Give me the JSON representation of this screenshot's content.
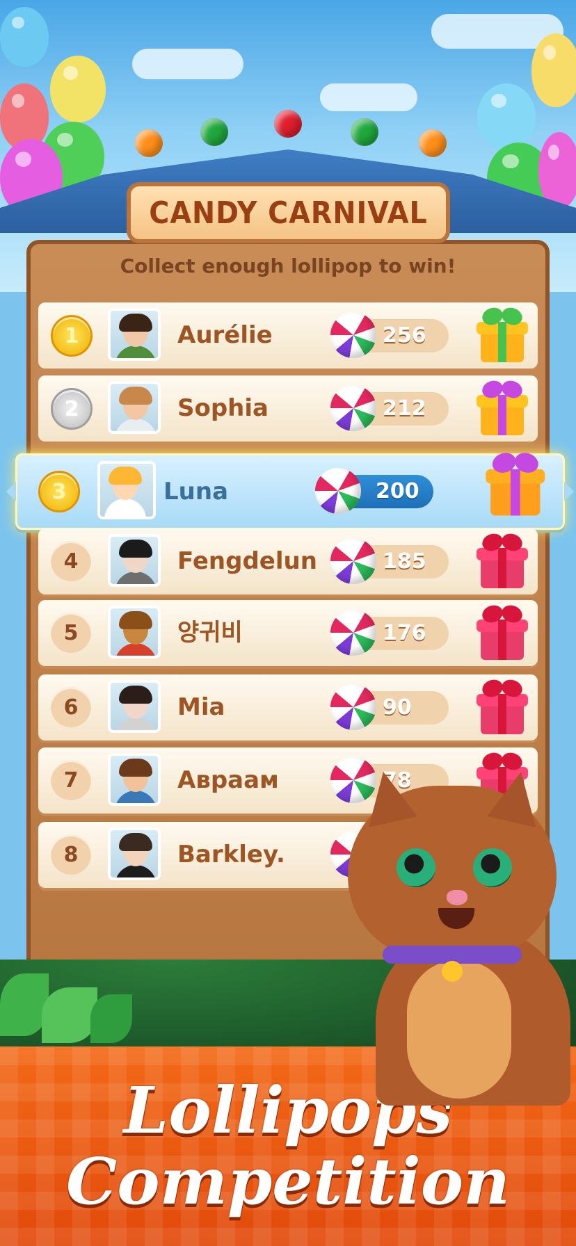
{
  "event": {
    "title": "CANDY CARNIVAL",
    "subtitle": "Collect enough lollipop to win!"
  },
  "leaderboard": [
    {
      "rank": "1",
      "name": "Aurélie",
      "score": "256",
      "medal": "gold",
      "highlight": false,
      "gift_color": "#ffb21a"
    },
    {
      "rank": "2",
      "name": "Sophia",
      "score": "212",
      "medal": "silver",
      "highlight": false,
      "gift_color": "#ffb21a"
    },
    {
      "rank": "3",
      "name": "Luna",
      "score": "200",
      "medal": "gold",
      "highlight": true,
      "gift_color": "#f7a21c"
    },
    {
      "rank": "4",
      "name": "Fengdelun",
      "score": "185",
      "medal": "plain",
      "highlight": false,
      "gift_color": "#e0305c"
    },
    {
      "rank": "5",
      "name": "양귀비",
      "score": "176",
      "medal": "plain",
      "highlight": false,
      "gift_color": "#e0305c"
    },
    {
      "rank": "6",
      "name": "Mia",
      "score": "90",
      "medal": "plain",
      "highlight": false,
      "gift_color": "#e0305c"
    },
    {
      "rank": "7",
      "name": "Авраам",
      "score": "78",
      "medal": "plain",
      "highlight": false,
      "gift_color": "#e0305c"
    },
    {
      "rank": "8",
      "name": "Barkley.",
      "score": "",
      "medal": "plain",
      "highlight": false,
      "gift_color": "#e0305c"
    }
  ],
  "promo": {
    "line1": "Lollipops",
    "line2": "Competition"
  },
  "colors": {
    "board_wood": "#b7763f",
    "roof_blue": "#2c5f9f",
    "banner_orange": "#e24a0b",
    "highlight_blue": "#a8daf7"
  }
}
